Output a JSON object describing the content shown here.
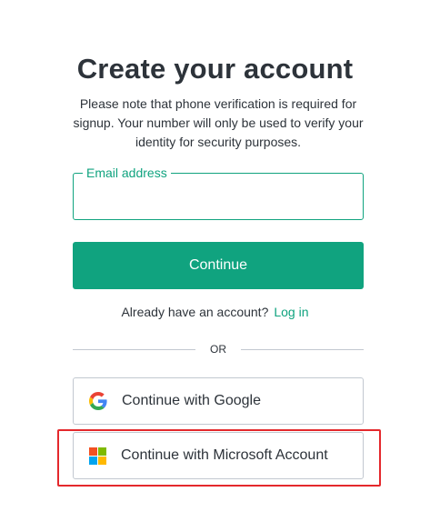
{
  "title": "Create your account",
  "subtitle": "Please note that phone verification is required for signup. Your number will only be used to verify your identity for security purposes.",
  "email": {
    "label": "Email address",
    "value": ""
  },
  "continue_label": "Continue",
  "login_prompt": {
    "text": "Already have an account?",
    "link": "Log in"
  },
  "divider_text": "OR",
  "social": {
    "google": {
      "label": "Continue with Google",
      "icon": "google-icon"
    },
    "microsoft": {
      "label": "Continue with Microsoft Account",
      "icon": "microsoft-icon"
    }
  },
  "colors": {
    "accent": "#10a37f",
    "text": "#2d333a",
    "border": "#c2c8d0",
    "highlight": "#e4282c"
  }
}
